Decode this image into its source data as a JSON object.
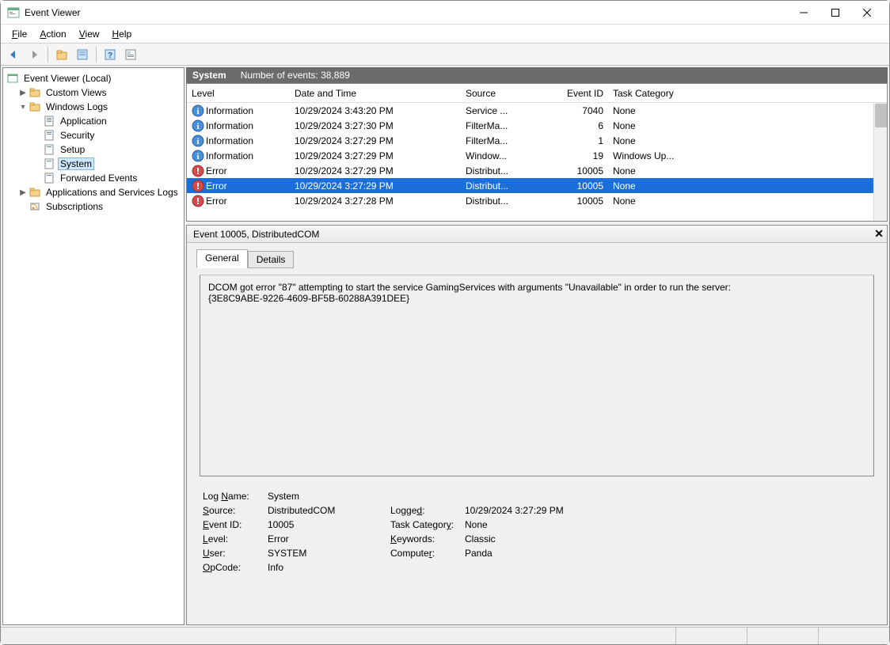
{
  "window": {
    "title": "Event Viewer"
  },
  "menu": {
    "file": "File",
    "action": "Action",
    "view": "View",
    "help": "Help"
  },
  "tree": {
    "root": "Event Viewer (Local)",
    "custom_views": "Custom Views",
    "windows_logs": "Windows Logs",
    "application": "Application",
    "security": "Security",
    "setup": "Setup",
    "system": "System",
    "forwarded": "Forwarded Events",
    "apps_services": "Applications and Services Logs",
    "subscriptions": "Subscriptions"
  },
  "list_header": {
    "log_name": "System",
    "count_label": "Number of events: 38,889"
  },
  "columns": {
    "level": "Level",
    "date": "Date and Time",
    "source": "Source",
    "event_id": "Event ID",
    "task_cat": "Task Category"
  },
  "events": [
    {
      "level": "Information",
      "icon": "info",
      "date": "10/29/2024 3:43:20 PM",
      "source": "Service ...",
      "eid": "7040",
      "cat": "None"
    },
    {
      "level": "Information",
      "icon": "info",
      "date": "10/29/2024 3:27:30 PM",
      "source": "FilterMa...",
      "eid": "6",
      "cat": "None"
    },
    {
      "level": "Information",
      "icon": "info",
      "date": "10/29/2024 3:27:29 PM",
      "source": "FilterMa...",
      "eid": "1",
      "cat": "None"
    },
    {
      "level": "Information",
      "icon": "info",
      "date": "10/29/2024 3:27:29 PM",
      "source": "Window...",
      "eid": "19",
      "cat": "Windows Up..."
    },
    {
      "level": "Error",
      "icon": "error",
      "date": "10/29/2024 3:27:29 PM",
      "source": "Distribut...",
      "eid": "10005",
      "cat": "None"
    },
    {
      "level": "Error",
      "icon": "error",
      "date": "10/29/2024 3:27:29 PM",
      "source": "Distribut...",
      "eid": "10005",
      "cat": "None",
      "selected": true
    },
    {
      "level": "Error",
      "icon": "error",
      "date": "10/29/2024 3:27:28 PM",
      "source": "Distribut...",
      "eid": "10005",
      "cat": "None"
    }
  ],
  "detail": {
    "title": "Event 10005, DistributedCOM",
    "tabs": {
      "general": "General",
      "details": "Details"
    },
    "message_line1": "DCOM got error \"87\" attempting to start the service GamingServices with arguments \"Unavailable\" in order to run the server:",
    "message_line2": "{3E8C9ABE-9226-4609-BF5B-60288A391DEE}",
    "props": {
      "log_name_k": "Log Name:",
      "log_name_v": "System",
      "source_k": "Source:",
      "source_v": "DistributedCOM",
      "logged_k": "Logged:",
      "logged_v": "10/29/2024 3:27:29 PM",
      "event_id_k": "Event ID:",
      "event_id_v": "10005",
      "task_cat_k": "Task Category:",
      "task_cat_v": "None",
      "level_k": "Level:",
      "level_v": "Error",
      "keywords_k": "Keywords:",
      "keywords_v": "Classic",
      "user_k": "User:",
      "user_v": "SYSTEM",
      "computer_k": "Computer:",
      "computer_v": "Panda",
      "opcode_k": "OpCode:",
      "opcode_v": "Info"
    }
  }
}
